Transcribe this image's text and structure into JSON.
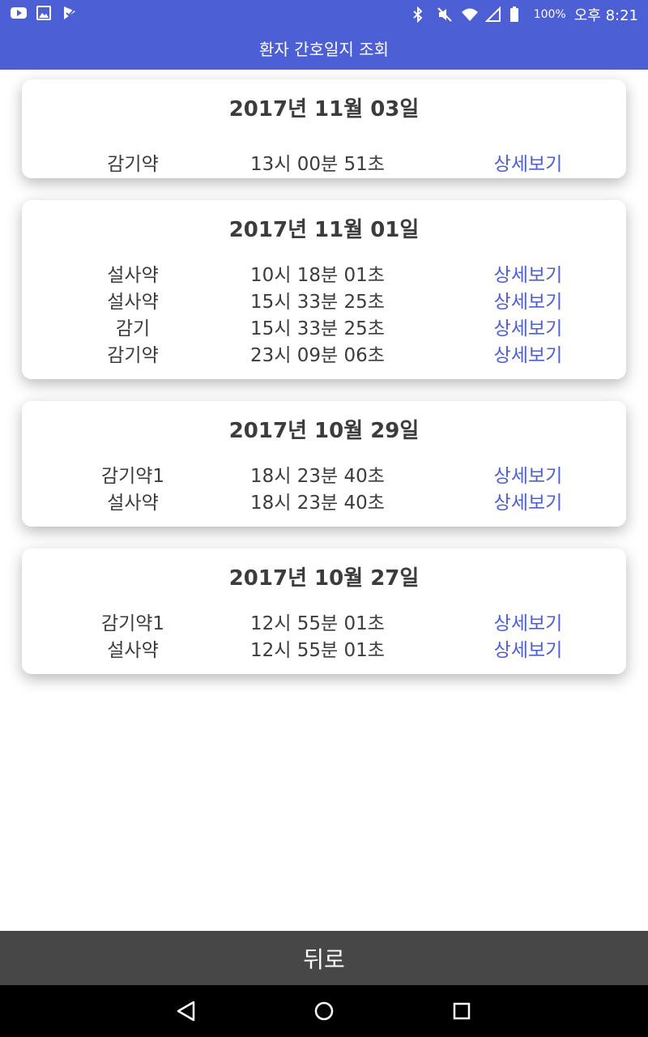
{
  "status_bar": {
    "battery_percent": "100%",
    "clock": "오후 8:21",
    "left_icons": [
      "youtube-icon",
      "image-icon",
      "app-notification-icon"
    ],
    "right_icons": [
      "bluetooth-icon",
      "mute-icon",
      "wifi-icon",
      "signal-icon",
      "battery-icon"
    ]
  },
  "app_bar": {
    "title": "환자 간호일지 조회"
  },
  "cards": [
    {
      "date": "2017년 11월 03일",
      "rows": [
        {
          "name": "감기약",
          "time": "13시 00분 51초",
          "action": "상세보기"
        }
      ]
    },
    {
      "date": "2017년 11월 01일",
      "rows": [
        {
          "name": "설사약",
          "time": "10시 18분 01초",
          "action": "상세보기"
        },
        {
          "name": "설사약",
          "time": "15시 33분 25초",
          "action": "상세보기"
        },
        {
          "name": "감기",
          "time": "15시 33분 25초",
          "action": "상세보기"
        },
        {
          "name": "감기약",
          "time": "23시 09분 06초",
          "action": "상세보기"
        }
      ]
    },
    {
      "date": "2017년 10월 29일",
      "rows": [
        {
          "name": "감기약1",
          "time": "18시 23분 40초",
          "action": "상세보기"
        },
        {
          "name": "설사약",
          "time": "18시 23분 40초",
          "action": "상세보기"
        }
      ]
    },
    {
      "date": "2017년 10월 27일",
      "rows": [
        {
          "name": "감기약1",
          "time": "12시 55분 01초",
          "action": "상세보기"
        },
        {
          "name": "설사약",
          "time": "12시 55분 01초",
          "action": "상세보기"
        }
      ]
    }
  ],
  "back_button": {
    "label": "뒤로"
  },
  "nav_bar": {
    "buttons": [
      "back-triangle-icon",
      "home-circle-icon",
      "recents-square-icon"
    ]
  },
  "colors": {
    "accent": "#4d5fd5",
    "text": "#3c3c3c",
    "back_bar": "#474747",
    "nav_bar": "#000000"
  }
}
